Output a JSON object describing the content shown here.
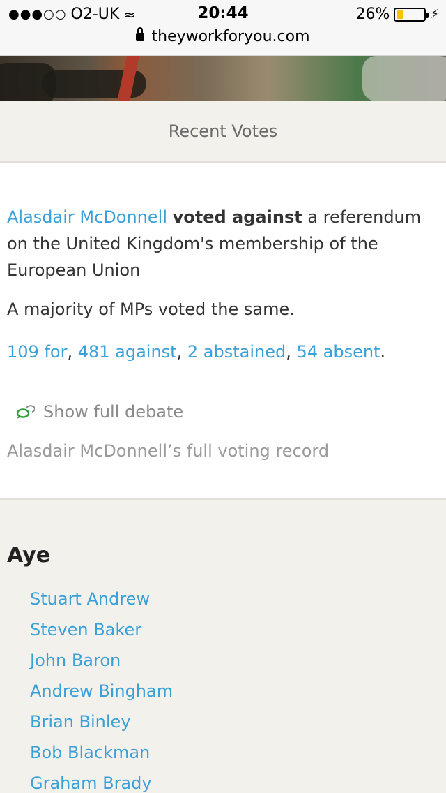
{
  "status_bar": {
    "carrier": "O2-UK",
    "time": "20:44",
    "battery_percent": "26%",
    "battery_level": 0.26,
    "url": "theyworkforyou.com"
  },
  "section_header": "Recent Votes",
  "vote": {
    "mp_name": "Alasdair McDonnell",
    "verb": "voted against",
    "description": "a referendum on the United Kingdom's membership of the European Union",
    "majority_note": "A majority of MPs voted the same.",
    "tallies": {
      "for": "109 for",
      "against": "481 against",
      "abstained": "2 abstained",
      "absent": "54 absent"
    },
    "show_debate": "Show full debate",
    "voting_record": "Alasdair McDonnell’s full voting record"
  },
  "aye": {
    "title": "Aye",
    "members": [
      "Stuart Andrew",
      "Steven Baker",
      "John Baron",
      "Andrew Bingham",
      "Brian Binley",
      "Bob Blackman",
      "Graham Brady"
    ]
  },
  "colors": {
    "link": "#3aa0d8",
    "section_bg": "#f3f1ec",
    "debate_icon": "#2e9e3a"
  }
}
